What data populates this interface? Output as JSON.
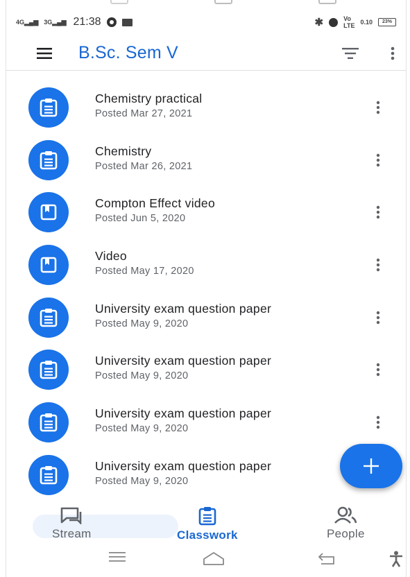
{
  "status_bar": {
    "network_left": "4G",
    "network_right": "3G",
    "time": "21:38",
    "network_speed": "0.10",
    "battery": "23%"
  },
  "app_bar": {
    "title": "B.Sc. Sem V"
  },
  "classwork": {
    "items": [
      {
        "title": "Chemistry practical",
        "posted": "Posted Mar 27, 2021",
        "icon": "assignment-icon"
      },
      {
        "title": "Chemistry",
        "posted": "Posted Mar 26, 2021",
        "icon": "assignment-icon"
      },
      {
        "title": "Compton Effect video",
        "posted": "Posted Jun 5, 2020",
        "icon": "material-icon"
      },
      {
        "title": "Video",
        "posted": "Posted May 17, 2020",
        "icon": "material-icon"
      },
      {
        "title": "University exam question paper",
        "posted": "Posted May 9, 2020",
        "icon": "assignment-icon"
      },
      {
        "title": "University exam question paper",
        "posted": "Posted May 9, 2020",
        "icon": "assignment-icon"
      },
      {
        "title": "University exam question paper",
        "posted": "Posted May 9, 2020",
        "icon": "assignment-icon"
      },
      {
        "title": "University exam question paper",
        "posted": "Posted May 9, 2020",
        "icon": "assignment-icon"
      }
    ]
  },
  "fab": {
    "icon": "plus-icon"
  },
  "bottom_nav": {
    "stream": "Stream",
    "classwork": "Classwork",
    "people": "People",
    "active": "classwork"
  },
  "colors": {
    "accent": "#1a73e8",
    "title_blue": "#1967d2",
    "secondary_text": "#5f6368"
  }
}
